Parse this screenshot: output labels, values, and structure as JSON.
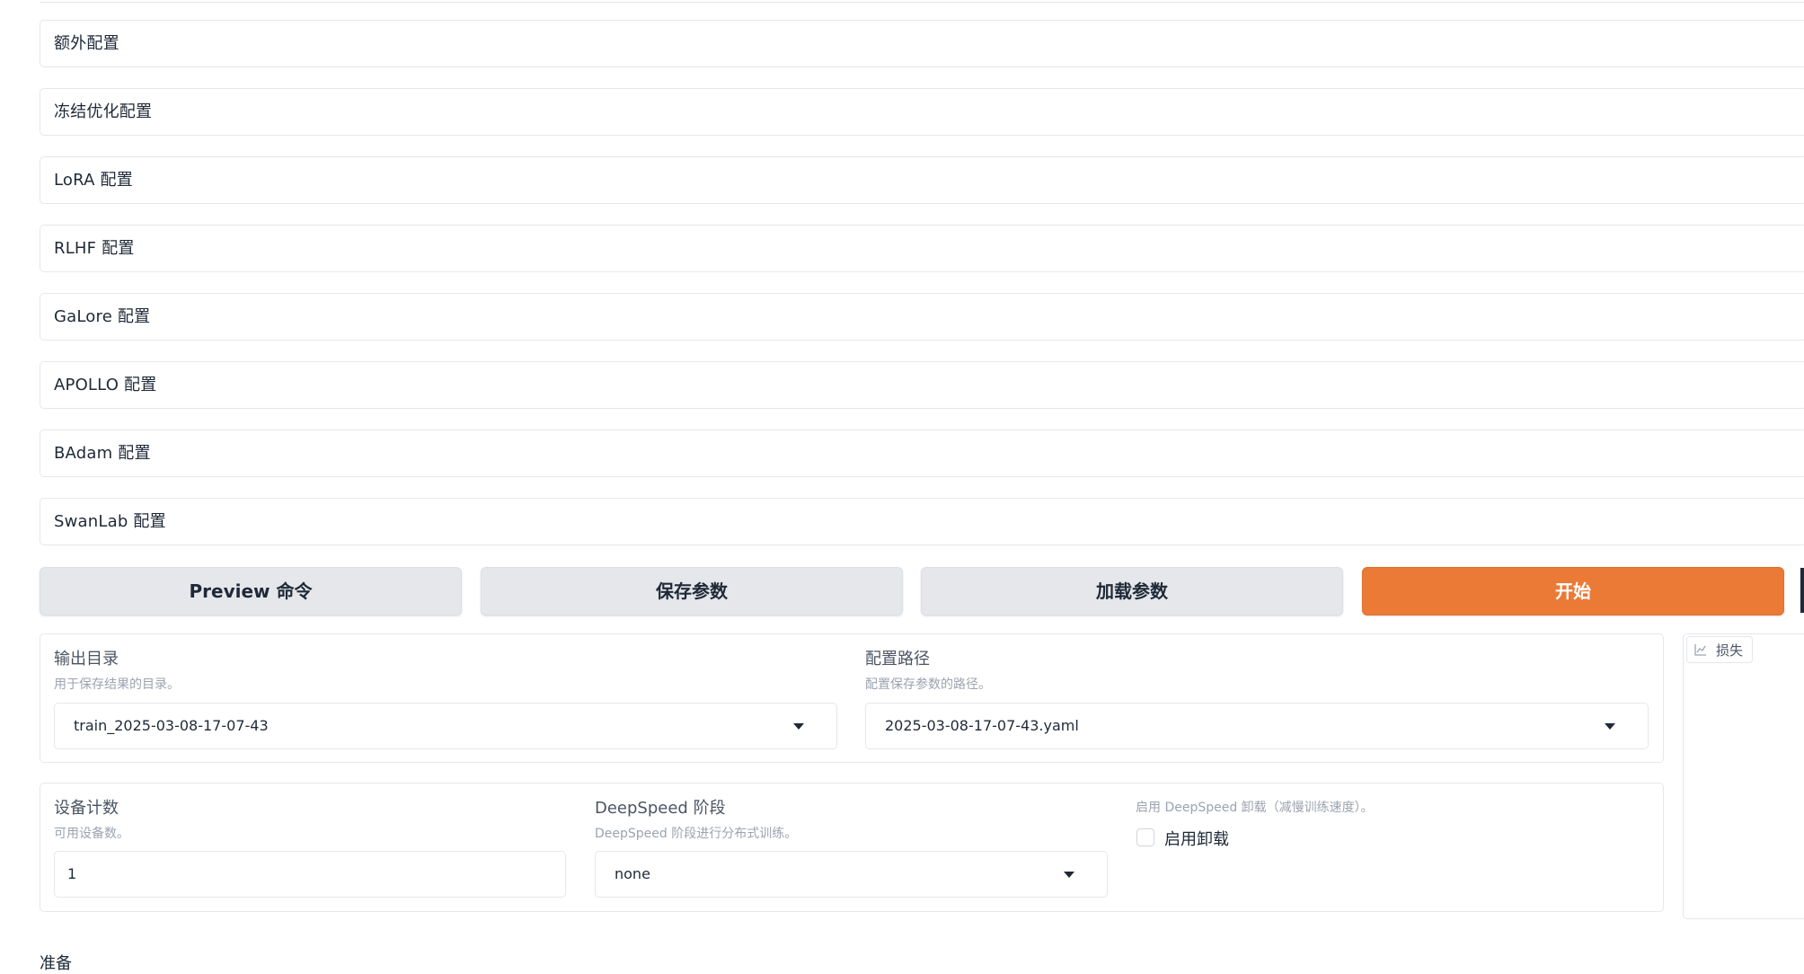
{
  "accordions": [
    {
      "label": "额外配置"
    },
    {
      "label": "冻结优化配置"
    },
    {
      "label": "LoRA 配置"
    },
    {
      "label": "RLHF 配置"
    },
    {
      "label": "GaLore 配置"
    },
    {
      "label": "APOLLO 配置"
    },
    {
      "label": "BAdam 配置"
    },
    {
      "label": "SwanLab 配置"
    }
  ],
  "actions": {
    "preview": "Preview 命令",
    "save": "保存参数",
    "load": "加载参数",
    "start": "开始"
  },
  "output_dir": {
    "label": "输出目录",
    "info": "用于保存结果的目录。",
    "value": "train_2025-03-08-17-07-43"
  },
  "config_path": {
    "label": "配置路径",
    "info": "配置保存参数的路径。",
    "value": "2025-03-08-17-07-43.yaml"
  },
  "device_count": {
    "label": "设备计数",
    "info": "可用设备数。",
    "value": "1"
  },
  "deepspeed_stage": {
    "label": "DeepSpeed 阶段",
    "info": "DeepSpeed 阶段进行分布式训练。",
    "value": "none"
  },
  "deepspeed_offload": {
    "info": "启用 DeepSpeed 卸载（减慢训练速度）。",
    "label": "启用卸载",
    "checked": false
  },
  "loss_plot": {
    "label": "损失"
  },
  "bottom": {
    "text": "准备"
  },
  "colors": {
    "primary": "#ea7a36",
    "secondary_button": "#e5e7eb",
    "border": "#e5e7eb"
  }
}
